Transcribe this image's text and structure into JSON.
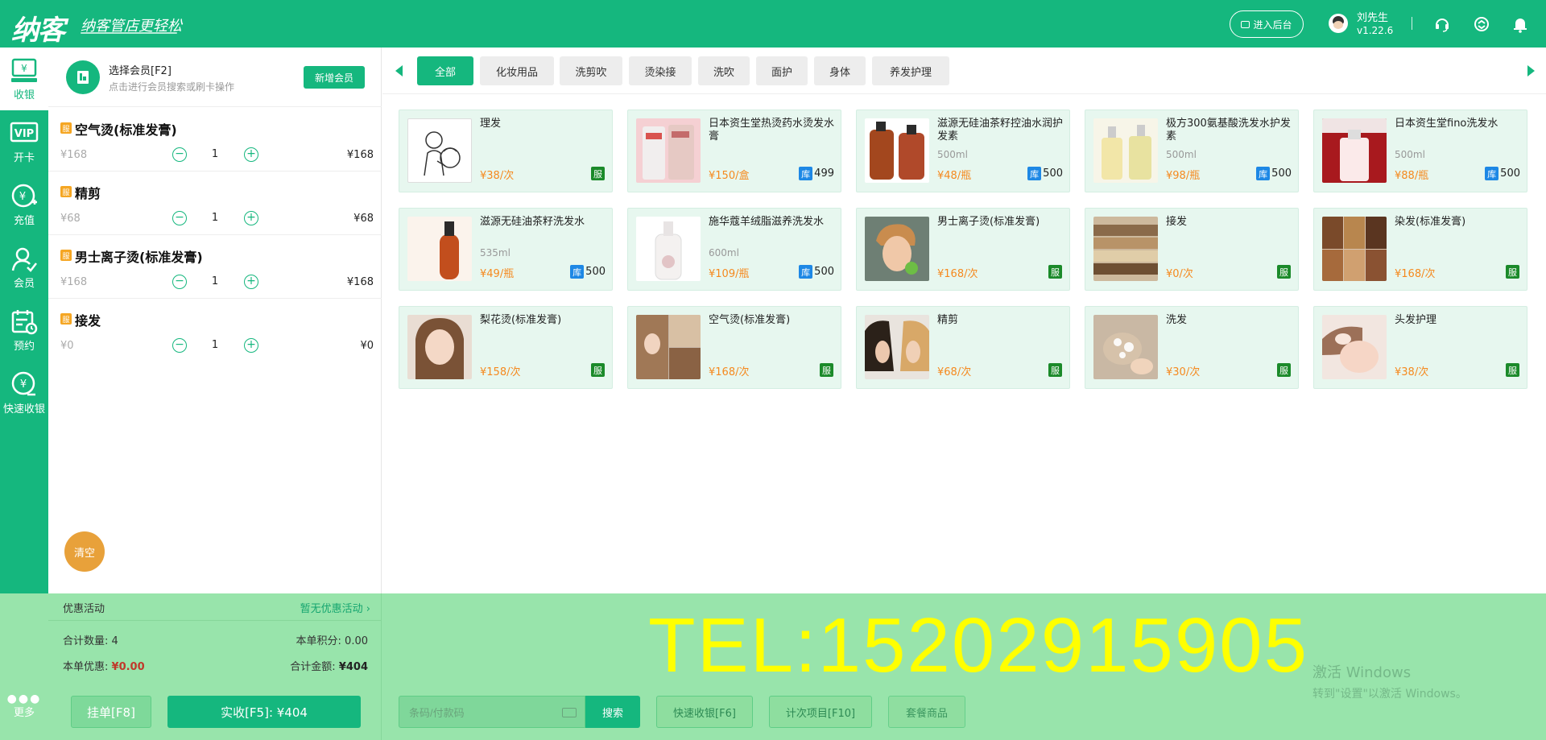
{
  "header": {
    "logo": "纳客",
    "slogan": "纳客管店更轻松",
    "admin_button": "进入后台",
    "user_name": "刘先生",
    "version": "v1.22.6",
    "icons": [
      "headset-icon",
      "refresh-icon",
      "bell-icon"
    ]
  },
  "nav": {
    "items": [
      {
        "label": "收银",
        "icon": "cashier-icon"
      },
      {
        "label": "开卡",
        "icon": "vip-card-icon"
      },
      {
        "label": "充值",
        "icon": "recharge-icon"
      },
      {
        "label": "会员",
        "icon": "member-icon"
      },
      {
        "label": "预约",
        "icon": "appointment-icon"
      },
      {
        "label": "快速收银",
        "icon": "quick-cashier-icon"
      }
    ],
    "more": "更多"
  },
  "member": {
    "title": "选择会员[F2]",
    "subtitle": "点击进行会员搜索或刷卡操作",
    "new_button": "新增会员"
  },
  "cart": {
    "tag": "服",
    "items": [
      {
        "name": "空气烫(标准发膏)",
        "price": "¥168",
        "qty": "1",
        "total": "¥168"
      },
      {
        "name": "精剪",
        "price": "¥68",
        "qty": "1",
        "total": "¥68"
      },
      {
        "name": "男士离子烫(标准发膏)",
        "price": "¥168",
        "qty": "1",
        "total": "¥168"
      },
      {
        "name": "接发",
        "price": "¥0",
        "qty": "1",
        "total": "¥0"
      }
    ],
    "clear_button": "清空"
  },
  "categories": [
    "全部",
    "化妆用品",
    "洗剪吹",
    "烫染接",
    "洗吹",
    "面护",
    "身体",
    "养发护理"
  ],
  "products": [
    {
      "name": "理发",
      "spec": "",
      "price": "¥38/次",
      "type": "服",
      "stock": ""
    },
    {
      "name": "日本资生堂热烫药水烫发水膏",
      "spec": "",
      "price": "¥150/盒",
      "type": "库",
      "stock": "499"
    },
    {
      "name": "滋源无硅油茶籽控油水润护发素",
      "spec": "500ml",
      "price": "¥48/瓶",
      "type": "库",
      "stock": "500"
    },
    {
      "name": "极方300氨基酸洗发水护发素",
      "spec": "500ml",
      "price": "¥98/瓶",
      "type": "库",
      "stock": "500"
    },
    {
      "name": "日本资生堂fino洗发水",
      "spec": "500ml",
      "price": "¥88/瓶",
      "type": "库",
      "stock": "500"
    },
    {
      "name": "滋源无硅油茶籽洗发水",
      "spec": "535ml",
      "price": "¥49/瓶",
      "type": "库",
      "stock": "500"
    },
    {
      "name": "施华蔻羊绒脂滋养洗发水",
      "spec": "600ml",
      "price": "¥109/瓶",
      "type": "库",
      "stock": "500"
    },
    {
      "name": "男士离子烫(标准发膏)",
      "spec": "",
      "price": "¥168/次",
      "type": "服",
      "stock": ""
    },
    {
      "name": "接发",
      "spec": "",
      "price": "¥0/次",
      "type": "服",
      "stock": ""
    },
    {
      "name": "染发(标准发膏)",
      "spec": "",
      "price": "¥168/次",
      "type": "服",
      "stock": ""
    },
    {
      "name": "梨花烫(标准发膏)",
      "spec": "",
      "price": "¥158/次",
      "type": "服",
      "stock": ""
    },
    {
      "name": "空气烫(标准发膏)",
      "spec": "",
      "price": "¥168/次",
      "type": "服",
      "stock": ""
    },
    {
      "name": "精剪",
      "spec": "",
      "price": "¥68/次",
      "type": "服",
      "stock": ""
    },
    {
      "name": "洗发",
      "spec": "",
      "price": "¥30/次",
      "type": "服",
      "stock": ""
    },
    {
      "name": "头发护理",
      "spec": "",
      "price": "¥38/次",
      "type": "服",
      "stock": ""
    }
  ],
  "summary": {
    "promo_label": "优惠活动",
    "promo_value": "暂无优惠活动 ›",
    "count_label": "合计数量:",
    "count_value": "4",
    "points_label": "本单积分:",
    "points_value": "0.00",
    "discount_label": "本单优惠:",
    "discount_value": "¥0.00",
    "amount_label": "合计金额:",
    "amount_value": "¥404",
    "hang_button": "挂单[F8]",
    "pay_button": "实收[F5]: ¥404"
  },
  "toolbar": {
    "barcode_placeholder": "条码/付款码",
    "search_button": "搜索",
    "quick_button": "快速收银[F6]",
    "count_button": "计次项目[F10]",
    "package_button": "套餐商品"
  },
  "watermark": {
    "tel": "TEL:15202915905",
    "windows_line1": "激活 Windows",
    "windows_line2": "转到\"设置\"以激活 Windows。"
  },
  "colors": {
    "primary": "#15b77e",
    "card_bg": "#e7f7ef",
    "price": "#f5891e",
    "service_badge": "#1b8a2a",
    "stock_badge": "#1e88e5",
    "bottom_bg": "#98e4ab",
    "tel_text": "#ffff00"
  }
}
